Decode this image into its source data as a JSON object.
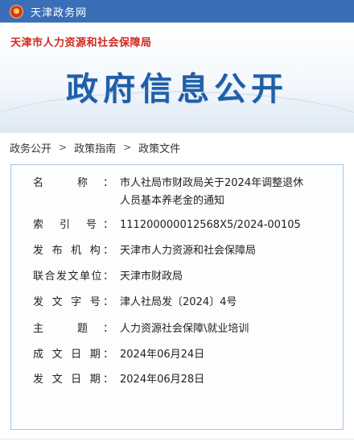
{
  "topbar": {
    "site_name": "天津政务网",
    "emblem_icon": "national-emblem-icon"
  },
  "banner": {
    "department": "天津市人力资源和社会保障局",
    "title": "政府信息公开"
  },
  "breadcrumb": {
    "items": [
      "政务公开",
      "政策指南",
      "政策文件"
    ],
    "separator": ">"
  },
  "document": {
    "fields": [
      {
        "label": "名 称：",
        "value": "市人社局市财政局关于2024年调整退休人员基本养老金的通知"
      },
      {
        "label": "索 引 号：",
        "value": "111200000012568X5/2024-00105"
      },
      {
        "label": "发 布 机 构：",
        "value": "天津市人力资源和社会保障局"
      },
      {
        "label": "联合发文单位：",
        "value": "天津市财政局"
      },
      {
        "label": "发 文 字 号：",
        "value": "津人社局发〔2024〕4号"
      },
      {
        "label": "主 题：",
        "value": "人力资源社会保障\\就业培训"
      },
      {
        "label": "成 文 日 期：",
        "value": "2024年06月24日"
      },
      {
        "label": "发 文 日 期：",
        "value": "2024年06月28日"
      }
    ]
  },
  "colors": {
    "topbar": "#3a6fb8",
    "title_blue": "#1f5fa8",
    "department_red": "#d5281f",
    "box_border": "#a9c4e4"
  }
}
